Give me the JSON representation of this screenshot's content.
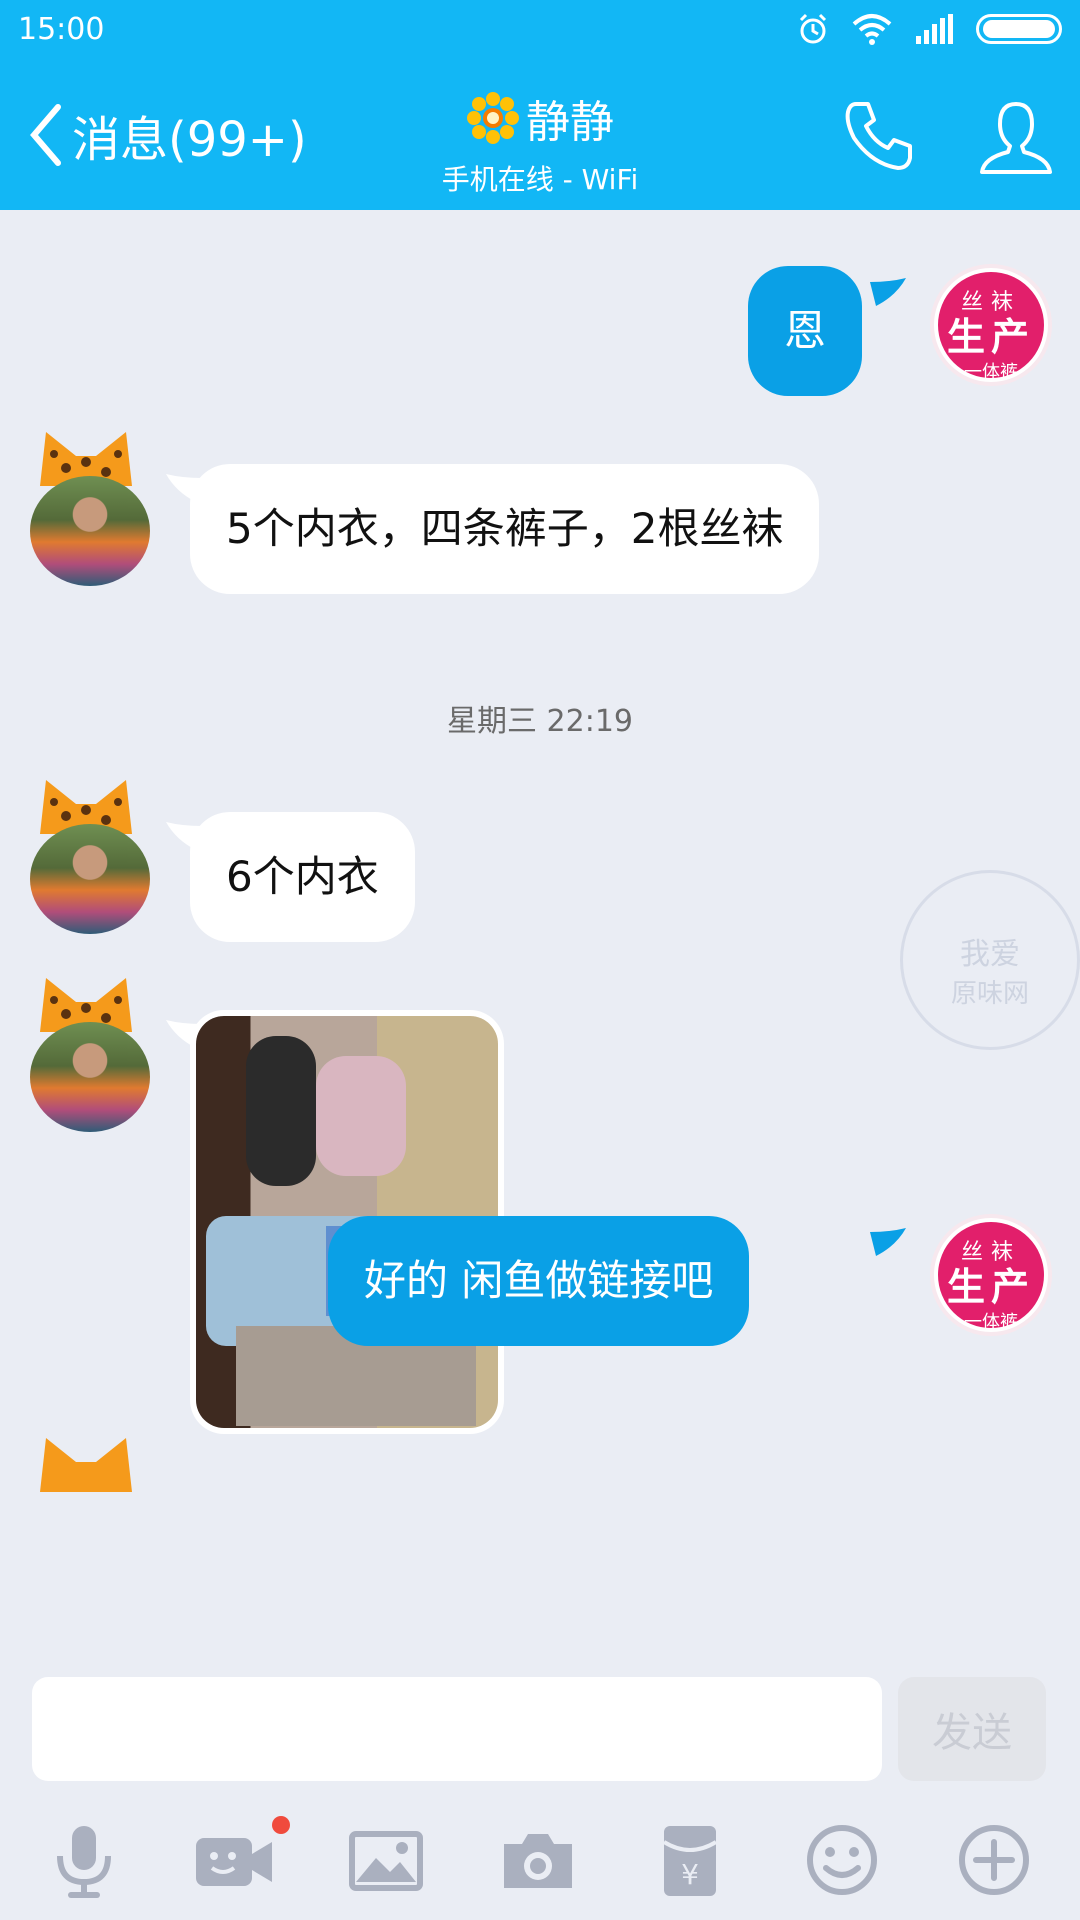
{
  "status_bar": {
    "time": "15:00"
  },
  "header": {
    "back_label": "消息(99+)",
    "contact_name": "静静",
    "contact_status": "手机在线 - WiFi"
  },
  "messages": {
    "m1": "恩",
    "m2": "5个内衣，四条裤子，2根丝袜",
    "timestamp": "星期三 22:19",
    "m3": "6个内衣",
    "m5": "好的        闲鱼做链接吧"
  },
  "my_avatar": {
    "line1": "丝袜",
    "line2": "生产",
    "line3": "一体裤"
  },
  "watermark": {
    "line1": "我爱",
    "line2": "原味网"
  },
  "input": {
    "placeholder": "",
    "send_label": "发送"
  },
  "toolbar": {
    "items": [
      "microphone-icon",
      "video-call-icon",
      "image-icon",
      "camera-icon",
      "red-packet-icon",
      "emoji-icon",
      "plus-icon"
    ]
  },
  "colors": {
    "accent": "#12b7f5",
    "out_bubble": "#0aa0e6",
    "background": "#eaedf4"
  }
}
